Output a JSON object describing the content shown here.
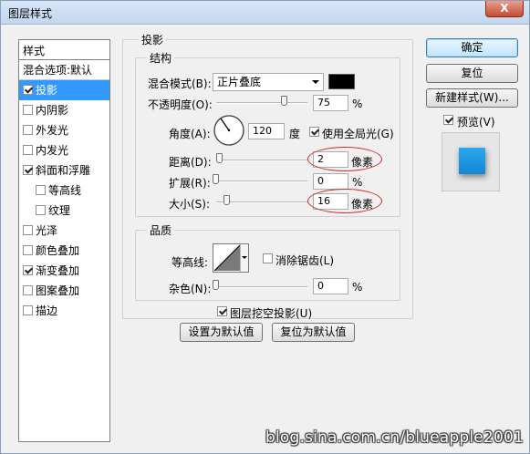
{
  "window": {
    "title": "图层样式",
    "close": "X"
  },
  "left_panel": {
    "header": "样式",
    "blend_item": "混合选项:默认",
    "items": [
      {
        "label": "投影",
        "checked": true,
        "selected": true
      },
      {
        "label": "内阴影",
        "checked": false
      },
      {
        "label": "外发光",
        "checked": false
      },
      {
        "label": "内发光",
        "checked": false
      },
      {
        "label": "斜面和浮雕",
        "checked": true
      },
      {
        "label": "等高线",
        "checked": false,
        "sub": true
      },
      {
        "label": "纹理",
        "checked": false,
        "sub": true
      },
      {
        "label": "光泽",
        "checked": false
      },
      {
        "label": "颜色叠加",
        "checked": false
      },
      {
        "label": "渐变叠加",
        "checked": true
      },
      {
        "label": "图案叠加",
        "checked": false
      },
      {
        "label": "描边",
        "checked": false
      }
    ]
  },
  "shadow": {
    "title": "投影",
    "structure": {
      "title": "结构",
      "blend_mode_label": "混合模式(B):",
      "blend_mode_value": "正片叠底",
      "blend_color": "#000000",
      "opacity_label": "不透明度(O):",
      "opacity_value": "75",
      "opacity_unit": "%",
      "opacity_level": 0.75,
      "angle_label": "角度(A):",
      "angle_value": "120",
      "angle_unit": "度",
      "global_light_label": "使用全局光(G)",
      "global_light_checked": true,
      "distance_label": "距离(D):",
      "distance_value": "2",
      "distance_unit": "像素",
      "spread_label": "扩展(R):",
      "spread_value": "0",
      "spread_unit": "%",
      "size_label": "大小(S):",
      "size_value": "16",
      "size_unit": "像素"
    },
    "quality": {
      "title": "品质",
      "contour_label": "等高线:",
      "anti_alias_label": "消除锯齿(L)",
      "anti_alias_checked": false,
      "noise_label": "杂色(N):",
      "noise_value": "0",
      "noise_unit": "%"
    },
    "knockout_label": "图层挖空投影(U)",
    "knockout_checked": true,
    "make_default": "设置为默认值",
    "reset_default": "复位为默认值"
  },
  "buttons": {
    "ok": "确定",
    "reset": "复位",
    "new_style": "新建样式(W)...",
    "preview_label": "预览(V)",
    "preview_checked": true
  },
  "colors": {
    "preview_square": "#1e9be0",
    "highlight_oval": "#d02a2a",
    "selection": "#3399ff"
  },
  "watermark": "blog.sina.com.cn/blueapple2001"
}
